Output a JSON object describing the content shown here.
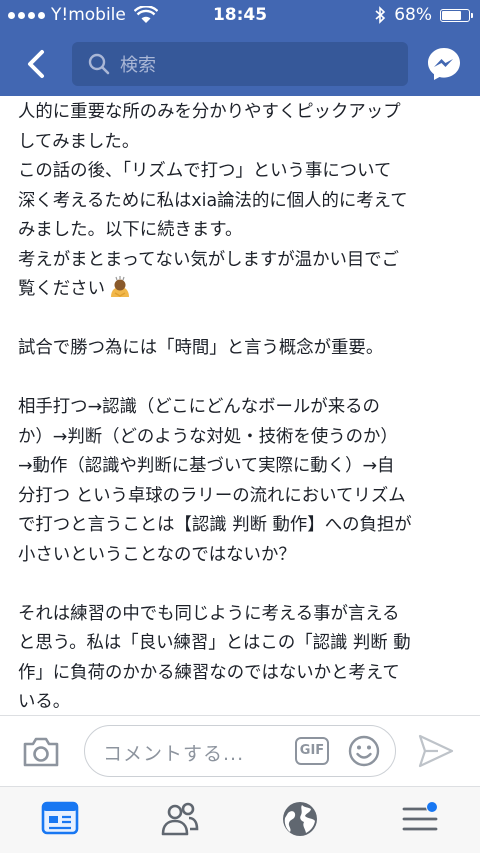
{
  "status_bar": {
    "carrier": "Y!mobile",
    "time": "18:45",
    "battery": "68%",
    "battery_level": 0.68
  },
  "nav": {
    "search_placeholder": "検索",
    "icons": [
      "back-chevron-icon",
      "search-icon",
      "messenger-icon"
    ]
  },
  "post": {
    "lines": [
      "人的に重要な所のみを分かりやすくピックアップ",
      "してみました。",
      "この話の後、「リズムで打つ」という事について",
      "深く考えるために私はxia論法的に個人的に考えて",
      "みました。以下に続きます。",
      "考えがまとまってない気がしますが温かい目でご",
      "覧ください"
    ],
    "emoji_icon": "bowing-person-emoji",
    "paragraph2": "試合で勝つ為には「時間」と言う概念が重要。",
    "paragraph3": [
      "相手打つ→認識（どこにどんなボールが来るの",
      "か）→判断（どのような対処・技術を使うのか）",
      "→動作（認識や判断に基づいて実際に動く）→自",
      "分打つ という卓球のラリーの流れにおいてリズム",
      "で打つと言うことは【認識 判断 動作】への負担が",
      "小さいということなのではないか？"
    ],
    "paragraph4": [
      "それは練習の中でも同じように考える事が言える",
      "と思う。私は「良い練習」とはこの「認識 判断 動",
      "作」に負荷のかかる練習なのではないかと考えて",
      "いる。"
    ]
  },
  "comment_bar": {
    "placeholder": "コメントする...",
    "gif_label": "GIF",
    "icons": [
      "camera-icon",
      "gif-icon",
      "smiley-icon",
      "send-icon"
    ]
  },
  "tabbar": {
    "tabs": [
      "news-feed-tab",
      "friends-tab",
      "globe-tab",
      "menu-tab"
    ],
    "accent": "#1877f2"
  },
  "colors": {
    "brand_blue": "#4267b2",
    "search_bg": "#365899"
  }
}
